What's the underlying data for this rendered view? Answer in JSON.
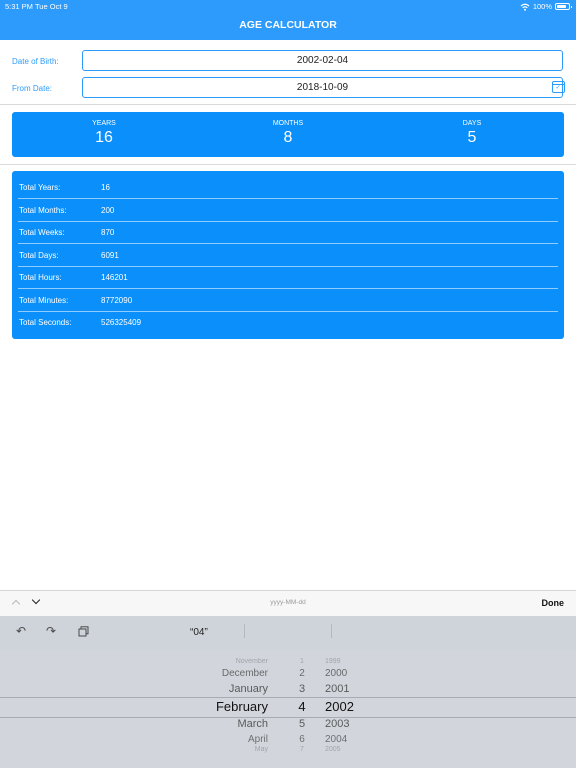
{
  "status_bar": {
    "time": "5:31 PM",
    "date": "Tue Oct 9",
    "battery": "100%"
  },
  "header": {
    "title": "AGE CALCULATOR"
  },
  "form": {
    "dob_label": "Date of Birth:",
    "dob_value": "2002-02-04",
    "from_label": "From Date:",
    "from_value": "2018-10-09"
  },
  "summary": [
    {
      "label": "YEARS",
      "value": "16"
    },
    {
      "label": "MONTHS",
      "value": "8"
    },
    {
      "label": "DAYS",
      "value": "5"
    }
  ],
  "totals": [
    {
      "label": "Total Years:",
      "value": "16"
    },
    {
      "label": "Total Months:",
      "value": "200"
    },
    {
      "label": "Total Weeks:",
      "value": "870"
    },
    {
      "label": "Total Days:",
      "value": "6091"
    },
    {
      "label": "Total Hours:",
      "value": "146201"
    },
    {
      "label": "Total Minutes:",
      "value": "8772090"
    },
    {
      "label": "Total Seconds:",
      "value": "526325409"
    }
  ],
  "keyboard": {
    "format_hint": "yyyy-MM-dd",
    "done_label": "Done",
    "suggestion": "“04”"
  },
  "picker": {
    "months": [
      "November",
      "December",
      "January",
      "February",
      "March",
      "April",
      "May"
    ],
    "days": [
      "1",
      "2",
      "3",
      "4",
      "5",
      "6",
      "7"
    ],
    "years": [
      "1999",
      "2000",
      "2001",
      "2002",
      "2003",
      "2004",
      "2005"
    ],
    "selected_index": 3
  },
  "colors": {
    "accent": "#2d9bfb",
    "card": "#0a8ffb"
  }
}
